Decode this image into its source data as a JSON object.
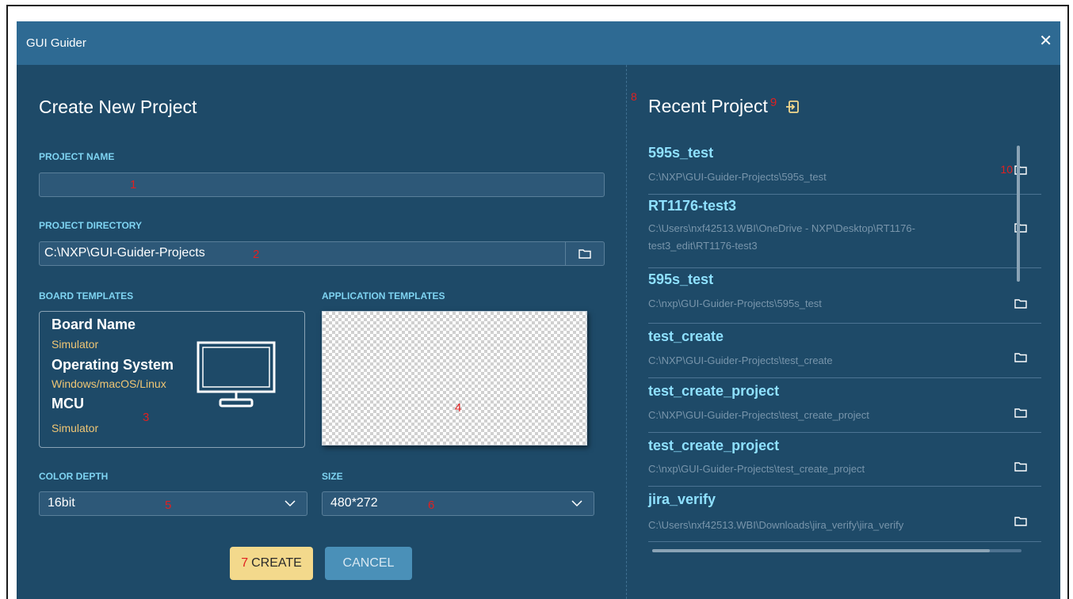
{
  "window": {
    "title": "GUI Guider",
    "close_glyph": "✕"
  },
  "left": {
    "heading": "Create New Project",
    "project_name": {
      "label": "PROJECT NAME",
      "value": "",
      "marker": "1"
    },
    "project_directory": {
      "label": "PROJECT DIRECTORY",
      "value": "C:\\NXP\\GUI-Guider-Projects",
      "marker": "2"
    },
    "board_templates": {
      "label": "BOARD TEMPLATES",
      "board_name_key": "Board Name",
      "board_name_value": "Simulator",
      "os_key": "Operating System",
      "os_value": "Windows/macOS/Linux",
      "mcu_key": "MCU",
      "mcu_value": "Simulator",
      "marker": "3",
      "icon": "monitor-icon"
    },
    "application_templates": {
      "label": "APPLICATION TEMPLATES",
      "marker": "4"
    },
    "color_depth": {
      "label": "COLOR DEPTH",
      "value": "16bit",
      "marker": "5"
    },
    "size": {
      "label": "SIZE",
      "value": "480*272",
      "marker": "6"
    },
    "create_button": {
      "marker": "7",
      "label": "CREATE"
    },
    "cancel_button": {
      "label": "CANCEL"
    }
  },
  "right": {
    "heading_marker": "8",
    "heading": "Recent Project",
    "import_marker": "9",
    "import_icon": "import-icon",
    "folder_marker": "10",
    "projects": [
      {
        "name": "595s_test",
        "path": "C:\\NXP\\GUI-Guider-Projects\\595s_test"
      },
      {
        "name": "RT1176-test3",
        "path": "C:\\Users\\nxf42513.WBI\\OneDrive - NXP\\Desktop\\RT1176-test3_edit\\RT1176-test3"
      },
      {
        "name": "595s_test",
        "path": "C:\\nxp\\GUI-Guider-Projects\\595s_test"
      },
      {
        "name": "test_create",
        "path": "C:\\NXP\\GUI-Guider-Projects\\test_create"
      },
      {
        "name": "test_create_project",
        "path": "C:\\NXP\\GUI-Guider-Projects\\test_create_project"
      },
      {
        "name": "test_create_project",
        "path": "C:\\nxp\\GUI-Guider-Projects\\test_create_project"
      },
      {
        "name": "jira_verify",
        "path": "C:\\Users\\nxf42513.WBI\\Downloads\\jira_verify\\jira_verify"
      }
    ]
  },
  "colors": {
    "accent_label": "#7fd4f2",
    "marker_red": "#e02020",
    "create_button": "#f3d98c",
    "cancel_button": "#4a90b8",
    "dialog_bg": "#1e4a68",
    "titlebar_bg": "#2e6a93"
  }
}
